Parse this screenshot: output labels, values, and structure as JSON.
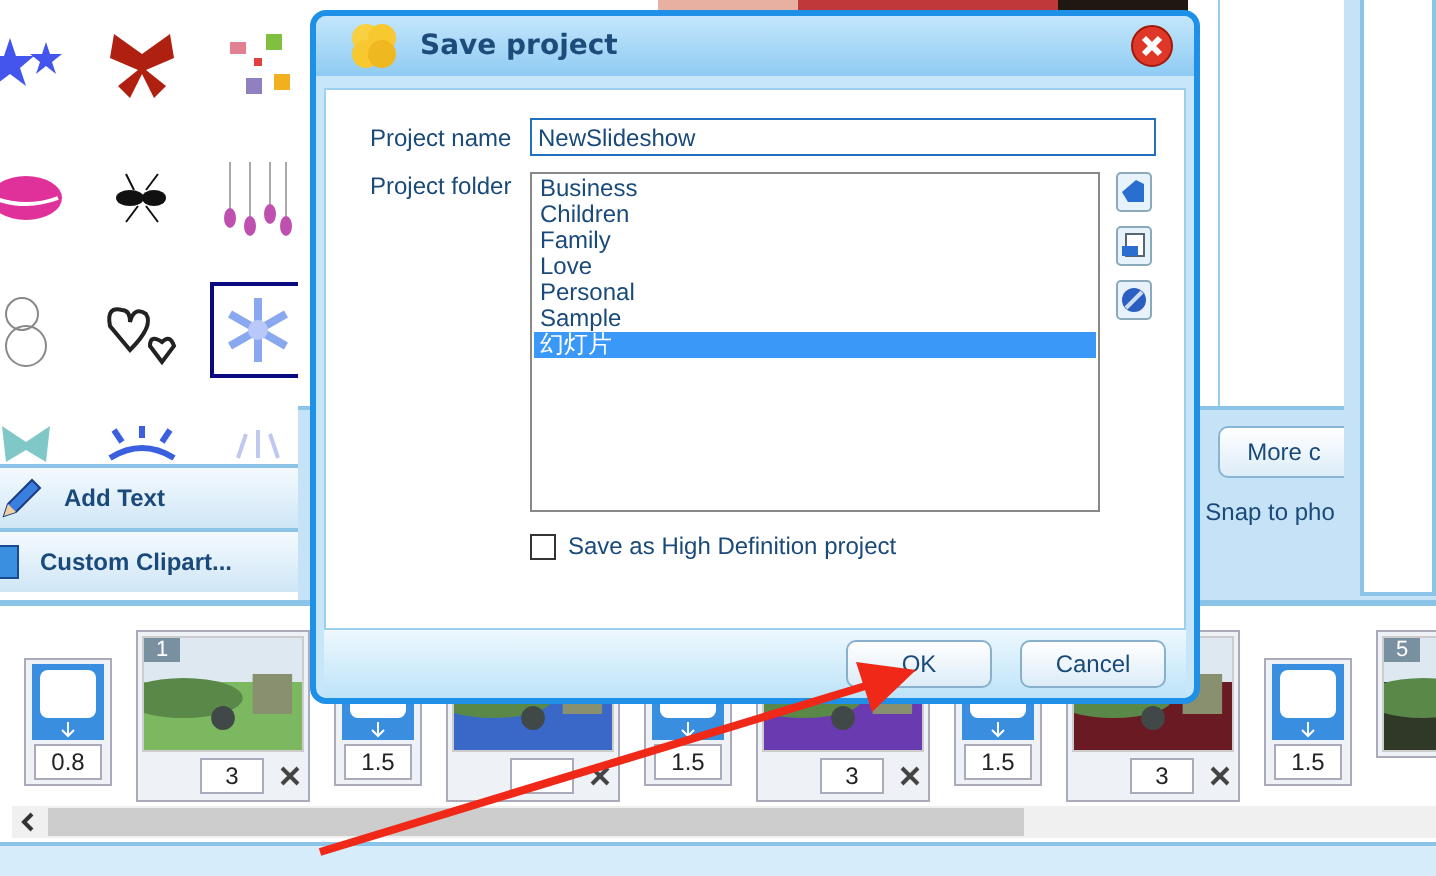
{
  "clipart": [
    {
      "selected": false
    },
    {
      "selected": false
    },
    {
      "selected": false
    },
    {
      "selected": false
    },
    {
      "selected": false
    },
    {
      "selected": false
    },
    {
      "selected": false
    },
    {
      "selected": false
    },
    {
      "selected": true
    },
    {
      "selected": false
    },
    {
      "selected": false
    },
    {
      "selected": false
    }
  ],
  "left_buttons": [
    {
      "label": "Add Text",
      "kind": "text"
    },
    {
      "label": "Custom Clipart...",
      "kind": "clipart"
    }
  ],
  "side_panel": {
    "button": "More c",
    "snap_label": "Snap to pho"
  },
  "dialog": {
    "title": "Save project",
    "name_label": "Project name",
    "name_value": "NewSlideshow",
    "folder_label": "Project folder",
    "folders": [
      {
        "label": "Business",
        "selected": false
      },
      {
        "label": "Children",
        "selected": false
      },
      {
        "label": "Family",
        "selected": false
      },
      {
        "label": "Love",
        "selected": false
      },
      {
        "label": "Personal",
        "selected": false
      },
      {
        "label": "Sample",
        "selected": false
      },
      {
        "label": "幻灯片",
        "selected": true
      }
    ],
    "hd_option": {
      "label": "Save as High Definition project",
      "checked": false
    },
    "buttons": [
      "OK",
      "Cancel"
    ]
  },
  "timeline": [
    {
      "kind": "transition",
      "duration": "0.8"
    },
    {
      "kind": "slide",
      "number": "1",
      "duration": "3"
    },
    {
      "kind": "transition",
      "duration": "1.5"
    },
    {
      "kind": "slide"
    },
    {
      "kind": "transition",
      "duration": "1.5"
    },
    {
      "kind": "slide",
      "duration": "3"
    },
    {
      "kind": "transition",
      "duration": "1.5"
    },
    {
      "kind": "slide",
      "duration": "3"
    },
    {
      "kind": "transition",
      "duration": "1.5"
    },
    {
      "kind": "slide",
      "number": "5"
    }
  ]
}
